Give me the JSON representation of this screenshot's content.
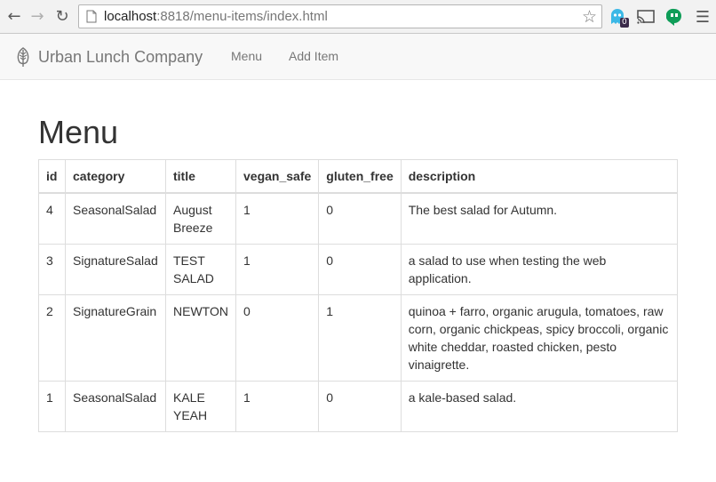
{
  "browser": {
    "url_host": "localhost",
    "url_rest": ":8818/menu-items/index.html",
    "ext_badge": "0"
  },
  "navbar": {
    "brand": "Urban Lunch Company",
    "links": [
      "Menu",
      "Add Item"
    ]
  },
  "page": {
    "title": "Menu"
  },
  "table": {
    "headers": [
      "id",
      "category",
      "title",
      "vegan_safe",
      "gluten_free",
      "description"
    ],
    "rows": [
      [
        "4",
        "SeasonalSalad",
        "August Breeze",
        "1",
        "0",
        "The best salad for Autumn."
      ],
      [
        "3",
        "SignatureSalad",
        "TEST SALAD",
        "1",
        "0",
        "a salad to use when testing the web application."
      ],
      [
        "2",
        "SignatureGrain",
        "NEWTON",
        "0",
        "1",
        "quinoa + farro, organic arugula, tomatoes, raw corn, organic chickpeas, spicy broccoli, organic white cheddar, roasted chicken, pesto vinaigrette."
      ],
      [
        "1",
        "SeasonalSalad",
        "KALE YEAH",
        "1",
        "0",
        "a kale-based salad."
      ]
    ]
  },
  "icons": {
    "back": "back-arrow-icon",
    "forward": "forward-arrow-icon",
    "reload": "reload-icon",
    "star": "star-icon",
    "menu": "hamburger-menu-icon",
    "brand": "leaf-icon"
  },
  "colors": {
    "navbar_bg": "#f8f8f8",
    "nav_text": "#777777",
    "border": "#dddddd"
  }
}
